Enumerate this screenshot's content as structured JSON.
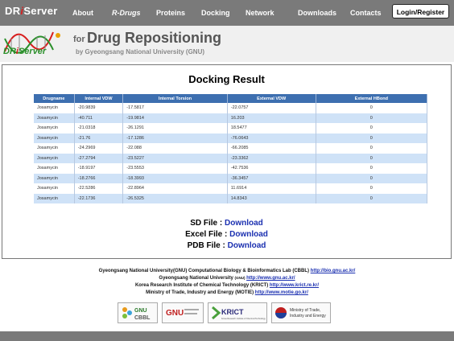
{
  "brand": {
    "part1": "DR",
    "part2": "i",
    "part3": "Server"
  },
  "nav": [
    "About",
    "R-Drugs",
    "Proteins",
    "Docking",
    "Network",
    "Downloads",
    "Contacts"
  ],
  "login_label": "Login/Register",
  "header": {
    "logo_part1": "DR",
    "logo_part2": "i",
    "logo_part3": "Server",
    "for": "for",
    "tagline": "Drug Repositioning",
    "by_line": "by  Gyeongsang National University (GNU)"
  },
  "page_title": "Docking Result",
  "table": {
    "columns": [
      "Drugname",
      "Internal VDW",
      "Internal Torsion",
      "External VDW",
      "External HBond"
    ],
    "rows": [
      [
        "Josamycin",
        "-20.9839",
        "-17.5817",
        "-22.0757",
        "0"
      ],
      [
        "Josamycin",
        "-40.711",
        "-19.9814",
        "16.203",
        "0"
      ],
      [
        "Josamycin",
        "-21.0318",
        "-26.1291",
        "18.5477",
        "0"
      ],
      [
        "Josamycin",
        "-21.76",
        "-17.1286",
        "-76.0643",
        "0"
      ],
      [
        "Josamycin",
        "-24.2969",
        "-22.088",
        "-66.2085",
        "0"
      ],
      [
        "Josamycin",
        "-27.2794",
        "-23.5227",
        "-23.3362",
        "0"
      ],
      [
        "Josamycin",
        "-18.9197",
        "-23.5553",
        "-42.7536",
        "0"
      ],
      [
        "Josamycin",
        "-18.2766",
        "-18.3993",
        "-36.3457",
        "0"
      ],
      [
        "Josamycin",
        "-22.5286",
        "-22.8964",
        "11.6914",
        "0"
      ],
      [
        "Josamycin",
        "-22.1736",
        "-26.5325",
        "14.8343",
        "0"
      ]
    ]
  },
  "downloads": [
    {
      "label": "SD File :",
      "link": "Download"
    },
    {
      "label": "Excel File :",
      "link": "Download"
    },
    {
      "label": "PDB File :",
      "link": "Download"
    }
  ],
  "credits": {
    "line1_text": "Gyeongsang National University(GNU) Computational Biology & Bioinformatics Lab (CBBL)",
    "line1_link": "http://bio.gnu.ac.kr/",
    "line2_text": "Gyeongsang National University",
    "line2_small": "(GNU)",
    "line2_link": "http://www.gnu.ac.kr/",
    "line3_text": "Korea Research Institute of Chemical Technology (KRICT)",
    "line3_link": "http://www.krict.re.kr/",
    "line4_text": "Ministry of Trade, Industry and Energy (MOTIE)",
    "line4_link": "http://www.motie.go.kr/"
  },
  "partners": {
    "p1_a": "GNU",
    "p1_b": "CBBL",
    "p2_a": "GNU",
    "p3_a": "KRICT",
    "p3_b": "Korea Research Institute of Chemical Technology",
    "p4_a": "Ministry of Trade,",
    "p4_b": "Industry and Energy"
  }
}
